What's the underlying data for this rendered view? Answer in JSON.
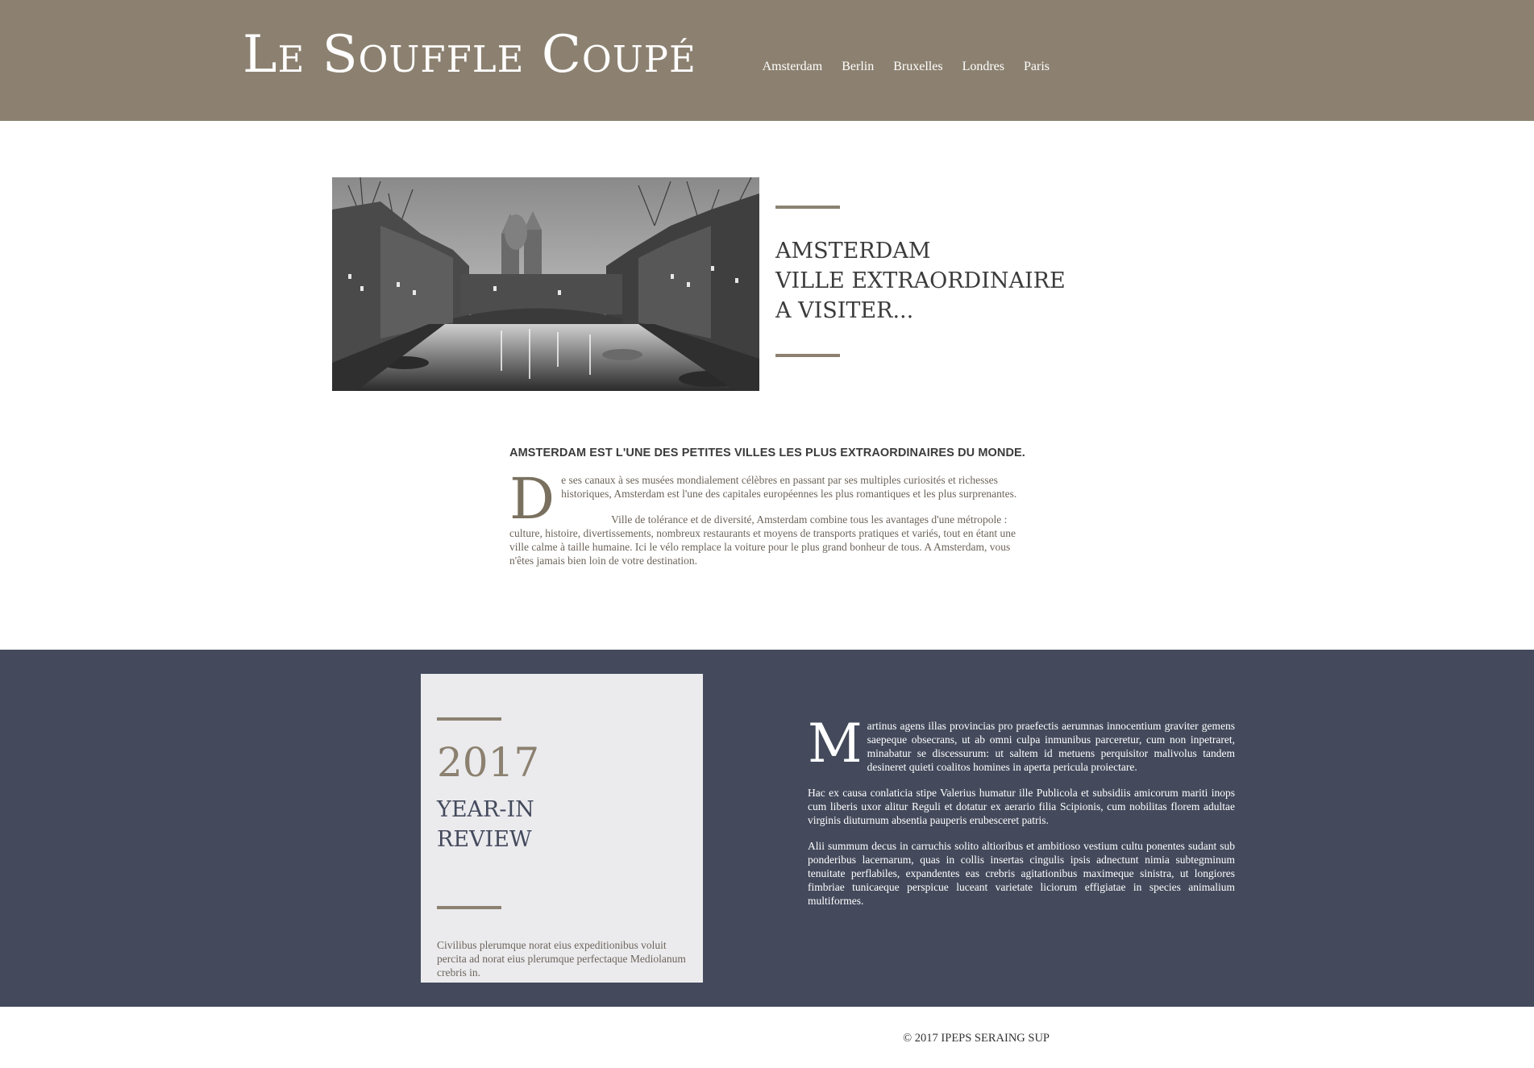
{
  "header": {
    "site_title": "Le Souffle Coupé",
    "nav": [
      "Amsterdam",
      "Berlin",
      "Bruxelles",
      "Londres",
      "Paris"
    ]
  },
  "hero": {
    "heading_lines": [
      "AMSTERDAM",
      "VILLE EXTRAORDINAIRE",
      "A VISITER..."
    ]
  },
  "article": {
    "headline": "AMSTERDAM EST L'UNE DES PETITES VILLES LES PLUS EXTRAORDINAIRES DU MONDE.",
    "dropcap": "D",
    "para1": "e ses canaux à ses musées mondialement célèbres en passant par ses multiples curiosités et richesses historiques, Amsterdam est l'une des capitales européennes les plus romantiques et les plus surprenantes.",
    "para2": "Ville de tolérance et de diversité, Amsterdam combine tous les avantages d'une métropole : culture, histoire, divertissements, nombreux restaurants et moyens de transports pratiques et variés, tout en étant une ville calme à taille humaine. Ici le vélo remplace la voiture pour le plus grand bonheur de tous. A Amsterdam, vous n'êtes jamais bien loin de votre destination."
  },
  "review": {
    "year": "2017",
    "title_lines": [
      "YEAR-IN",
      "REVIEW"
    ],
    "caption": "Civilibus plerumque norat eius expeditionibus voluit percita ad norat eius plerumque perfectaque Mediolanum crebris in.",
    "dropcap": "M",
    "para1": "artinus agens illas provincias pro praefectis aerumnas innocentium graviter gemens saepeque obsecrans, ut ab omni culpa inmunibus parceretur, cum non inpetraret, minabatur se discessurum: ut saltem id metuens perquisitor malivolus tandem desineret quieti coalitos homines in aperta pericula proiectare.",
    "para2": "Hac ex causa conlaticia stipe Valerius humatur ille Publicola et subsidiis amicorum mariti inops cum liberis uxor alitur Reguli et dotatur ex aerario filia Scipionis, cum nobilitas florem adultae virginis diuturnum absentia pauperis erubesceret patris.",
    "para3": "Alii summum decus in carruchis solito altioribus et ambitioso vestium cultu ponentes sudant sub ponderibus lacernarum, quas in collis insertas cingulis ipsis adnectunt nimia subtegminum tenuitate perflabiles, expandentes eas crebris agitationibus maximeque sinistra, ut longiores fimbriae tunicaeque perspicue luceant varietate liciorum effigiatae in species animalium multiformes."
  },
  "footer": {
    "copyright": "© 2017 IPEPS SERAING SUP"
  },
  "colors": {
    "header_bg": "#8c8170",
    "accent": "#8c8170",
    "review_bg": "#444a5c",
    "card_bg": "#ebebee",
    "body_text": "#6c6459"
  }
}
